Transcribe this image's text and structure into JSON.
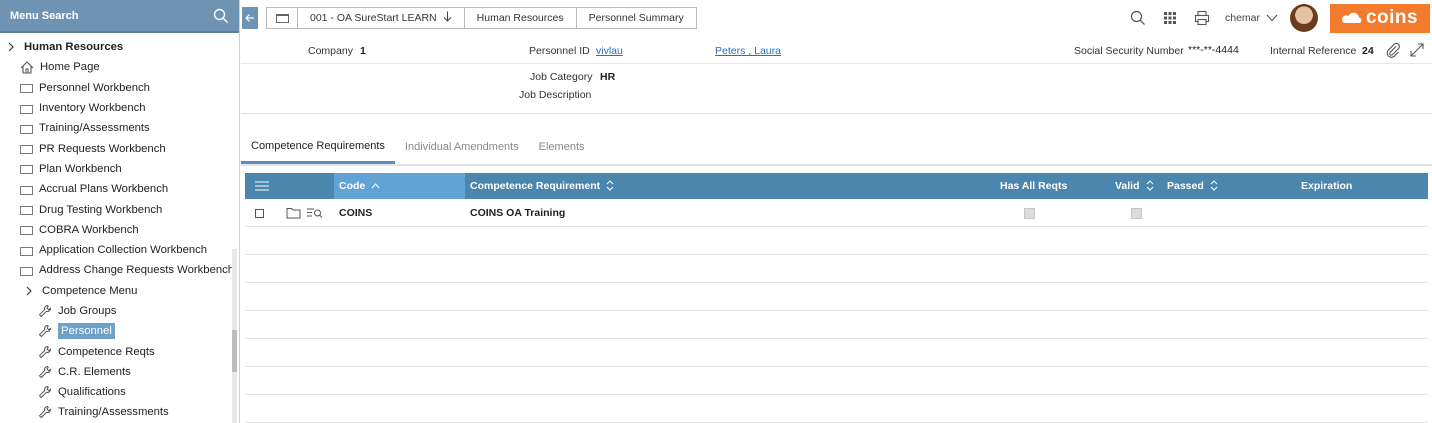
{
  "sidebar": {
    "search_label": "Menu Search",
    "root": {
      "label": "Human Resources"
    },
    "items": [
      {
        "label": "Home Page",
        "icon": "home-icon"
      },
      {
        "label": "Personnel Workbench",
        "icon": "folder-icon"
      },
      {
        "label": "Inventory Workbench",
        "icon": "folder-icon"
      },
      {
        "label": "Training/Assessments",
        "icon": "folder-icon"
      },
      {
        "label": "PR Requests Workbench",
        "icon": "folder-icon"
      },
      {
        "label": "Plan Workbench",
        "icon": "folder-icon"
      },
      {
        "label": "Accrual Plans Workbench",
        "icon": "folder-icon"
      },
      {
        "label": "Drug Testing Workbench",
        "icon": "folder-icon"
      },
      {
        "label": "COBRA Workbench",
        "icon": "folder-icon"
      },
      {
        "label": "Application Collection Workbench",
        "icon": "folder-icon"
      },
      {
        "label": "Address Change Requests Workbench",
        "icon": "folder-icon"
      }
    ],
    "submenu": {
      "label": "Competence Menu"
    },
    "subitems": [
      {
        "label": "Job Groups",
        "icon": "wrench-icon"
      },
      {
        "label": "Personnel",
        "icon": "wrench-icon",
        "selected": true
      },
      {
        "label": "Competence Reqts",
        "icon": "wrench-icon"
      },
      {
        "label": "C.R. Elements",
        "icon": "wrench-icon"
      },
      {
        "label": "Qualifications",
        "icon": "wrench-icon"
      },
      {
        "label": "Training/Assessments",
        "icon": "wrench-icon"
      }
    ]
  },
  "breadcrumbs": [
    {
      "label": "001 - OA SureStart LEARN"
    },
    {
      "label": "Human Resources"
    },
    {
      "label": "Personnel Summary"
    }
  ],
  "user": {
    "name": "chemar"
  },
  "brand": {
    "logo_text": "coins",
    "color": "#f47a2e"
  },
  "header": {
    "company_label": "Company",
    "company_value": "1",
    "personnel_id_label": "Personnel ID",
    "personnel_id_value": "vivlau",
    "personnel_name": "Peters , Laura",
    "ssn_label": "Social Security Number",
    "ssn_value": "***-**-4444",
    "internal_ref_label": "Internal Reference",
    "internal_ref_value": "24",
    "job_category_label": "Job Category",
    "job_category_value": "HR",
    "job_description_label": "Job Description",
    "job_description_value": ""
  },
  "tabs": [
    {
      "label": "Competence Requirements",
      "active": true
    },
    {
      "label": "Individual Amendments"
    },
    {
      "label": "Elements"
    }
  ],
  "grid": {
    "columns": {
      "code": "Code",
      "requirement": "Competence Requirement",
      "has_all": "Has All Reqts",
      "valid": "Valid",
      "passed": "Passed",
      "expiration": "Expiration"
    },
    "rows": [
      {
        "code": "COINS",
        "requirement": "COINS OA Training",
        "has_all": false,
        "valid": false,
        "passed": "",
        "expiration": ""
      }
    ]
  },
  "colors": {
    "header_blue": "#4a86ad",
    "active_col": "#62a3d6",
    "sidebar_blue": "#6f94b3"
  }
}
